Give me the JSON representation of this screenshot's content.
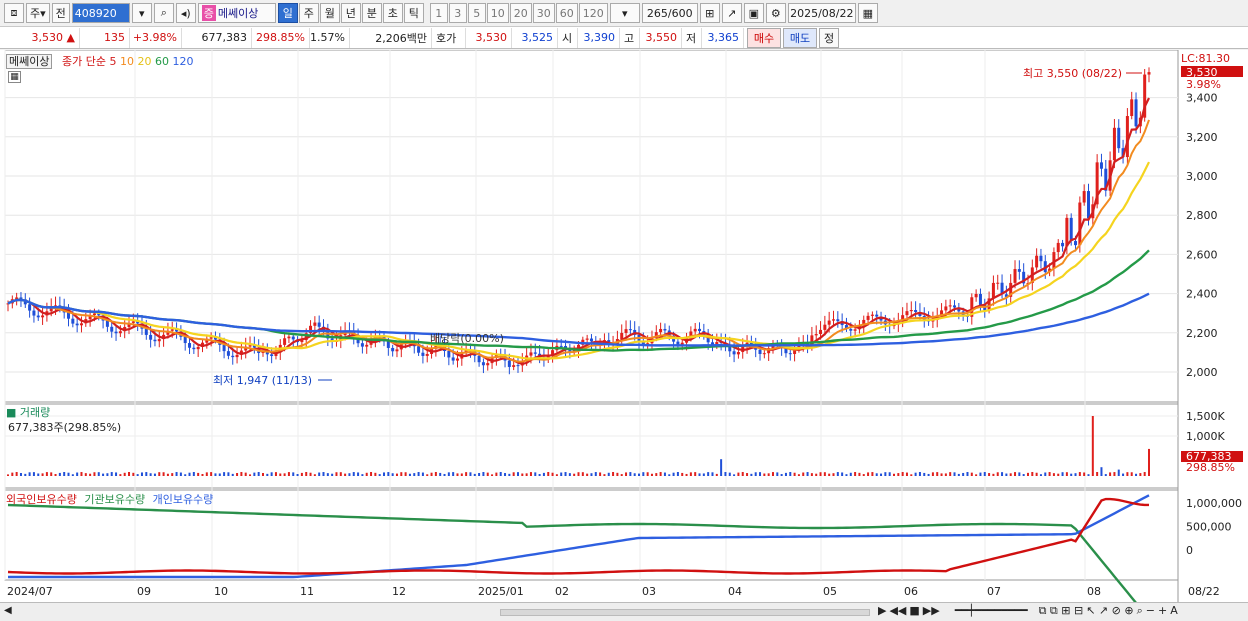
{
  "toolbar": {
    "market": "주",
    "prev": "전",
    "code": "408920",
    "stock_badge": "증",
    "stock_name": "메쎄이상",
    "periods": [
      "일",
      "주",
      "월",
      "년",
      "분",
      "초",
      "틱"
    ],
    "active_period": "일",
    "intervals": [
      "1",
      "3",
      "5",
      "10",
      "20",
      "30",
      "60",
      "120"
    ],
    "count": "265",
    "count_total": "/600",
    "date": "2025/08/22"
  },
  "quote": {
    "price": "3,530",
    "arrow": "▲",
    "change": "135",
    "change_pct": "+3.98%",
    "volume": "677,383",
    "volume_ratio": "298.85%",
    "turnover": "1.57%",
    "amount": "2,206백만",
    "hoga_label": "호가",
    "hoga_ask": "3,530",
    "hoga_bid": "3,525",
    "open_label": "시",
    "open": "3,390",
    "high_label": "고",
    "high": "3,550",
    "low_label": "저",
    "low": "3,365",
    "buy": "매수",
    "sell": "매도",
    "extra": "정"
  },
  "price_panel": {
    "stock_tag": "메쎄이상",
    "ma_label": "종가 단순",
    "ma_periods": [
      "5",
      "10",
      "20",
      "60",
      "120"
    ],
    "lc": "LC:81.30",
    "current": "3,530",
    "current_pct": "3.98%",
    "high_annot": "최고 3,550 (08/22)",
    "low_annot": "최저 1,947 (11/13)",
    "div_annot": "배당락(0.00%)",
    "yticks": [
      "3,400",
      "3,200",
      "3,000",
      "2,800",
      "2,600",
      "2,400",
      "2,200",
      "2,000"
    ]
  },
  "volume_panel": {
    "title": "거래량",
    "value": "677,383주(298.85%)",
    "yticks": [
      "1,500K",
      "1,000K"
    ],
    "current": "677,383",
    "current_pct": "298.85%"
  },
  "holding_panel": {
    "labels": [
      "외국인보유수량",
      "기관보유수량",
      "개인보유수량"
    ],
    "yticks": [
      "1,000,000",
      "500,000",
      "0"
    ]
  },
  "xaxis": [
    "2024/07",
    "09",
    "10",
    "11",
    "12",
    "2025/01",
    "02",
    "03",
    "04",
    "05",
    "06",
    "07",
    "08",
    "08/22"
  ],
  "colors": {
    "up": "#e0201c",
    "down": "#1f4fd8",
    "ma5": "#d21f1f",
    "ma10": "#f28b1f",
    "ma20": "#f5d41f",
    "ma60": "#249a48",
    "ma120": "#2e5fe0"
  }
}
